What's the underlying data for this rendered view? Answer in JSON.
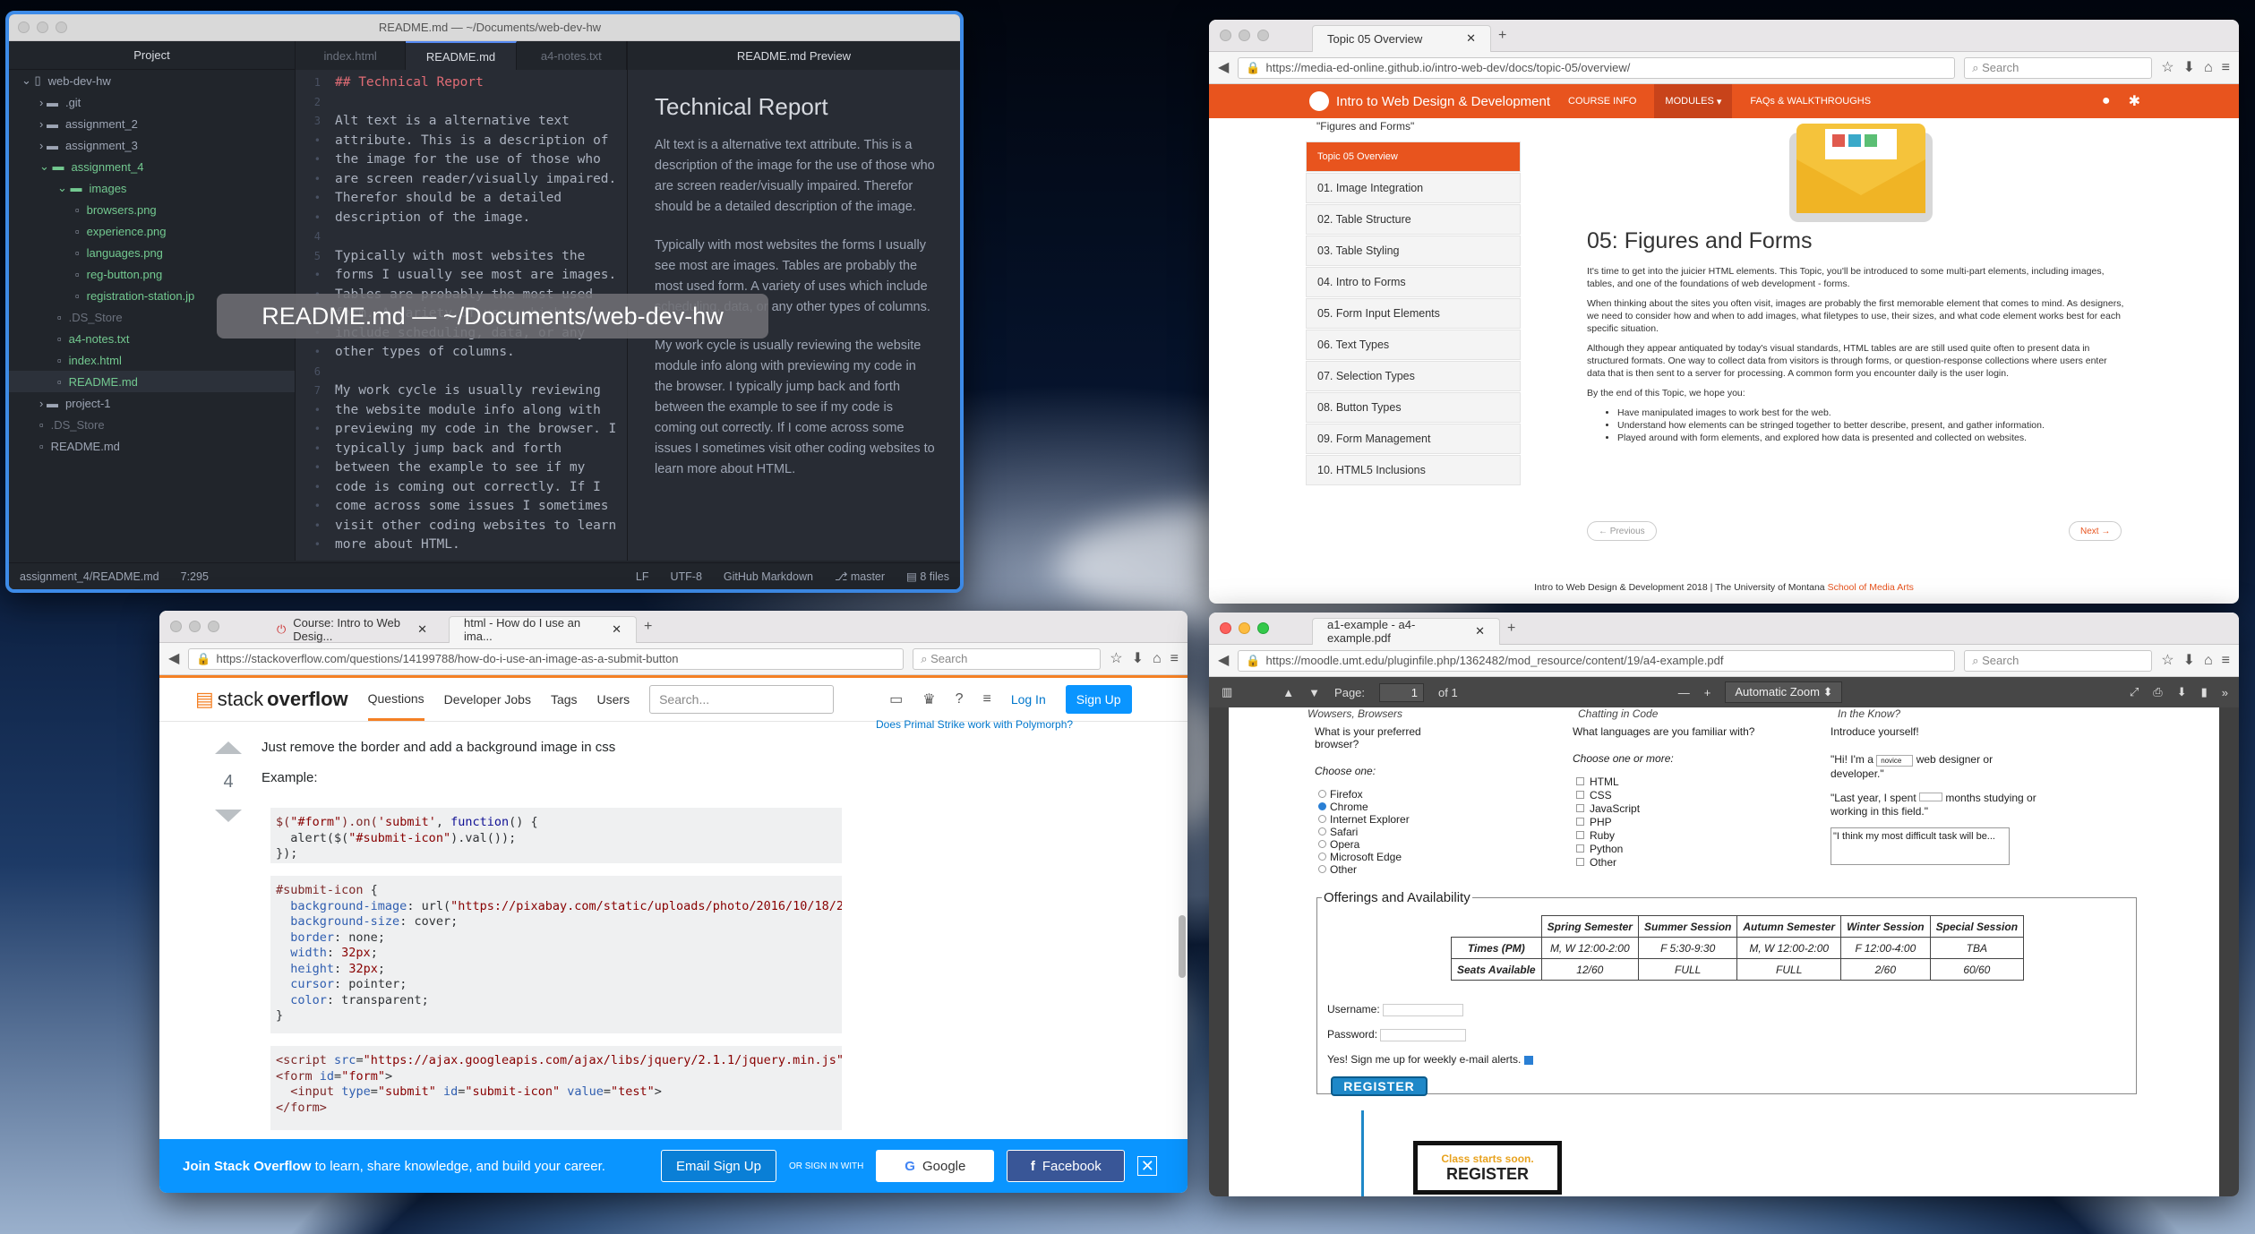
{
  "atom": {
    "title": "README.md — ~/Documents/web-dev-hw",
    "tree_header": "Project",
    "tree": [
      {
        "label": "web-dev-hw",
        "indent": 0,
        "kind": "repo"
      },
      {
        "label": ".git",
        "indent": 1,
        "kind": "folder"
      },
      {
        "label": "assignment_2",
        "indent": 1,
        "kind": "folder"
      },
      {
        "label": "assignment_3",
        "indent": 1,
        "kind": "folder"
      },
      {
        "label": "assignment_4",
        "indent": 1,
        "kind": "folder-open"
      },
      {
        "label": "images",
        "indent": 2,
        "kind": "folder-open"
      },
      {
        "label": "browsers.png",
        "indent": 3,
        "kind": "file"
      },
      {
        "label": "experience.png",
        "indent": 3,
        "kind": "file"
      },
      {
        "label": "languages.png",
        "indent": 3,
        "kind": "file"
      },
      {
        "label": "reg-button.png",
        "indent": 3,
        "kind": "file"
      },
      {
        "label": "registration-station.jp",
        "indent": 3,
        "kind": "file"
      },
      {
        "label": ".DS_Store",
        "indent": 2,
        "kind": "dim"
      },
      {
        "label": "a4-notes.txt",
        "indent": 2,
        "kind": "file"
      },
      {
        "label": "index.html",
        "indent": 2,
        "kind": "file"
      },
      {
        "label": "README.md",
        "indent": 2,
        "kind": "selected"
      },
      {
        "label": "project-1",
        "indent": 1,
        "kind": "folder"
      },
      {
        "label": ".DS_Store",
        "indent": 1,
        "kind": "dim"
      },
      {
        "label": "README.md",
        "indent": 1,
        "kind": "plain"
      }
    ],
    "tabs": [
      "index.html",
      "README.md",
      "a4-notes.txt"
    ],
    "code": "## Technical Report\n\nAlt text is a alternative text\nattribute. This is a description of\nthe image for the use of those who\nare screen reader/visually impaired.\nTherefor should be a detailed\ndescription of the image.\n\nTypically with most websites the\nforms I usually see most are images.\nTables are probably the most used\nform. A variety of uses which\ninclude scheduling, data, or any\nother types of columns.\n\nMy work cycle is usually reviewing\nthe website module info along with\npreviewing my code in the browser. I\ntypically jump back and forth\nbetween the example to see if my\ncode is coming out correctly. If I\ncome across some issues I sometimes\nvisit other coding websites to learn\nmore about HTML.",
    "preview_tab": "README.md Preview",
    "preview_title": "Technical Report",
    "preview_paras": [
      "Alt text is a alternative text attribute. This is a description of the image for the use of those who are screen reader/visually impaired. Therefor should be a detailed description of the image.",
      "Typically with most websites the forms I usually see most are images. Tables are probably the most used form. A variety of uses which include scheduling, data, or any other types of columns.",
      "My work cycle is usually reviewing the website module info along with previewing my code in the browser. I typically jump back and forth between the example to see if my code is coming out correctly. If I come across some issues I sometimes visit other coding websites to learn more about HTML."
    ],
    "status": {
      "path": "assignment_4/README.md",
      "pos": "7:295",
      "eol": "LF",
      "enc": "UTF-8",
      "grammar": "GitHub Markdown",
      "branch": "master",
      "files": "8 files"
    },
    "overlay": "README.md — ~/Documents/web-dev-hw"
  },
  "ff1": {
    "tab": "Topic 05 Overview",
    "url": "https://media-ed-online.github.io/intro-web-dev/docs/topic-05/overview/",
    "search": "Search",
    "brand": "Intro to Web Design & Development",
    "menu": [
      "COURSE INFO",
      "MODULES",
      "FAQs & WALKTHROUGHS"
    ],
    "side_top": "\"Figures and Forms\"",
    "side_active": "Topic 05 Overview",
    "side": [
      "01. Image Integration",
      "02. Table Structure",
      "03. Table Styling",
      "04. Intro to Forms",
      "05. Form Input Elements",
      "06. Text Types",
      "07. Selection Types",
      "08. Button Types",
      "09. Form Management",
      "10. HTML5 Inclusions"
    ],
    "heading": "05: Figures and Forms",
    "paras": [
      "It's time to get into the juicier HTML elements. This Topic, you'll be introduced to some multi-part elements, including images, tables, and one of the foundations of web development - forms.",
      "When thinking about the sites you often visit, images are probably the first memorable element that comes to mind. As designers, we need to consider how and when to add images, what filetypes to use, their sizes, and what code element works best for each specific situation.",
      "Although they appear antiquated by today's visual standards, HTML tables are are still used quite often to present data in structured formats. One way to collect data from visitors is through forms, or question-response collections where users enter data that is then sent to a server for processing. A common form you encounter daily is the user login.",
      "By the end of this Topic, we hope you:"
    ],
    "bullets": [
      "Have manipulated images to work best for the web.",
      "Understand how elements can be stringed together to better describe, present, and gather information.",
      "Played around with form elements, and explored how data is presented and collected on websites."
    ],
    "prev": "← Previous",
    "next": "Next →",
    "footer": "Intro to Web Design & Development 2018 | The University of Montana",
    "footer_link": "School of Media Arts"
  },
  "ff2": {
    "tab1": "Course: Intro to Web Desig...",
    "tab2": "html - How do I use an ima...",
    "url": "https://stackoverflow.com/questions/14199788/how-do-i-use-an-image-as-a-submit-button",
    "search": "Search",
    "nav": [
      "Questions",
      "Developer Jobs",
      "Tags",
      "Users"
    ],
    "so_search": "Search...",
    "login": "Log In",
    "signup": "Sign Up",
    "votes": "4",
    "answer": "Just remove the border and add a background image in css",
    "example": "Example:",
    "side_link": "Does Primal Strike work with Polymorph?",
    "banner_text": "to learn, share knowledge, and build your career.",
    "banner_bold": "Join Stack Overflow",
    "email_btn": "Email Sign Up",
    "or": "OR SIGN IN WITH",
    "google": "Google",
    "facebook": "Facebook"
  },
  "ff3": {
    "tab": "a1-example - a4-example.pdf",
    "url": "https://moodle.umt.edu/pluginfile.php/1362482/mod_resource/content/19/a4-example.pdf",
    "search": "Search",
    "page_label": "Page:",
    "page": "1",
    "of": "of 1",
    "zoom": "Automatic Zoom",
    "captions": [
      "Wowsers, Browsers",
      "Chatting in Code",
      "In the Know?"
    ],
    "q1": "What is your preferred browser?",
    "q1_sub": "Choose one:",
    "browsers": [
      "Firefox",
      "Chrome",
      "Internet Explorer",
      "Safari",
      "Opera",
      "Microsoft Edge",
      "Other"
    ],
    "q2": "What languages are you familiar with?",
    "q2_sub": "Choose one or more:",
    "langs": [
      "HTML",
      "CSS",
      "JavaScript",
      "PHP",
      "Ruby",
      "Python",
      "Other"
    ],
    "q3": "Introduce yourself!",
    "intro1a": "\"Hi! I'm a",
    "intro1_sel": "novice",
    "intro1b": "web designer or developer.\"",
    "intro2a": "\"Last year, I spent",
    "intro2b": "months studying or working in this field.\"",
    "intro3": "\"I think my most difficult task will be...",
    "legend": "Offerings and Availability",
    "table_head": [
      "Spring Semester",
      "Summer Session",
      "Autumn Semester",
      "Winter Session",
      "Special Session"
    ],
    "row1": [
      "Times (PM)",
      "M, W 12:00-2:00",
      "F 5:30-9:30",
      "M, W 12:00-2:00",
      "F 12:00-4:00",
      "TBA"
    ],
    "row2": [
      "Seats Available",
      "12/60",
      "FULL",
      "FULL",
      "2/60",
      "60/60"
    ],
    "username": "Username:",
    "password": "Password:",
    "emails": "Yes! Sign me up for weekly e-mail alerts.",
    "register": "REGISTER",
    "sign1": "Class starts soon.",
    "sign2": "REGISTER"
  }
}
